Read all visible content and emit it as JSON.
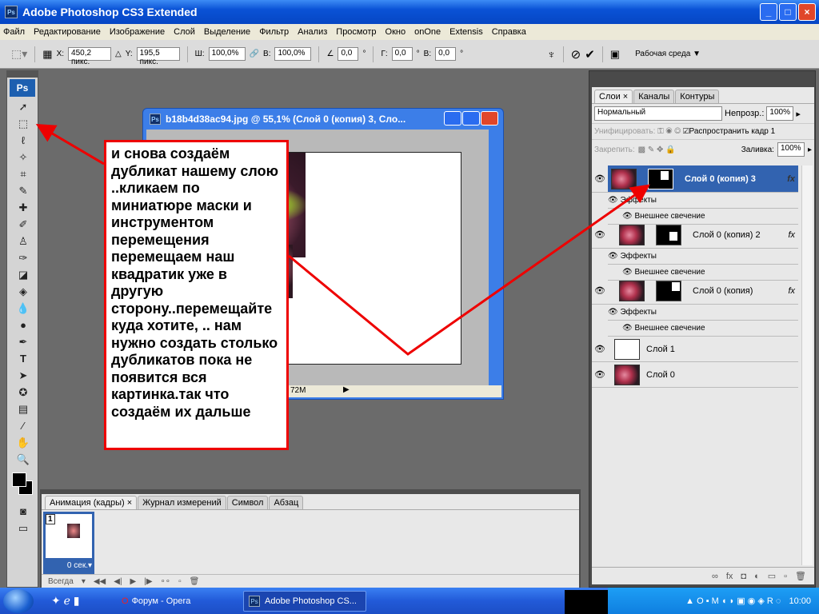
{
  "window": {
    "title": "Adobe Photoshop CS3 Extended",
    "app_icon": "Ps"
  },
  "menu": [
    "Файл",
    "Редактирование",
    "Изображение",
    "Слой",
    "Выделение",
    "Фильтр",
    "Анализ",
    "Просмотр",
    "Окно",
    "onOne",
    "Extensis",
    "Справка"
  ],
  "options": {
    "x_label": "X:",
    "x": "450,2 пикс.",
    "y_label": "Y:",
    "y": "195,5 пикс.",
    "w_label": "Ш:",
    "w": "100,0%",
    "h_label": "В:",
    "h": "100,0%",
    "angle": "0,0",
    "g_label": "Г:",
    "g": "0,0",
    "v_label": "В:",
    "v": "0,0",
    "deg": "°",
    "workspace": "Рабочая среда ▼"
  },
  "toolbox": {
    "logo": "Ps"
  },
  "document": {
    "title": "b18b4d38ac94.jpg @ 55,1% (Слой 0 (копия) 3, Сло...",
    "status": "72M"
  },
  "note": "и снова создаём дубликат нашему слою ..кликаем по миниатюре маски и инструментом перемещения перемещаем наш квадратик уже в другую сторону..перемещайте куда хотите, .. нам нужно создать столько дубликатов пока не появится вся картинка.так что создаём их дальше",
  "layers_panel": {
    "tabs": [
      "Слои ×",
      "Каналы",
      "Контуры"
    ],
    "blend_mode": "Нормальный",
    "opacity_label": "Непрозр.:",
    "opacity": "100%",
    "unify_label": "Унифицировать:",
    "propagate_label": "Распространить кадр 1",
    "lock_label": "Закрепить:",
    "fill_label": "Заливка:",
    "fill": "100%",
    "effects_label": "Эффекты",
    "glow_label": "Внешнее свечение",
    "fx": "fx",
    "layers": [
      {
        "name": "Слой 0 (копия) 3",
        "selected": true
      },
      {
        "name": "Слой 0 (копия) 2",
        "selected": false
      },
      {
        "name": "Слой 0 (копия)",
        "selected": false
      },
      {
        "name": "Слой 1",
        "selected": false
      },
      {
        "name": "Слой 0",
        "selected": false
      }
    ]
  },
  "animation_panel": {
    "tabs": [
      "Анимация (кадры) ×",
      "Журнал измерений",
      "Символ",
      "Абзац"
    ],
    "frame_number": "1",
    "frame_delay": "0 сек.▾",
    "loop": "Всегда"
  },
  "taskbar": {
    "items": [
      "Форум - Opera",
      "Adobe Photoshop CS..."
    ],
    "clock": "10:00"
  }
}
